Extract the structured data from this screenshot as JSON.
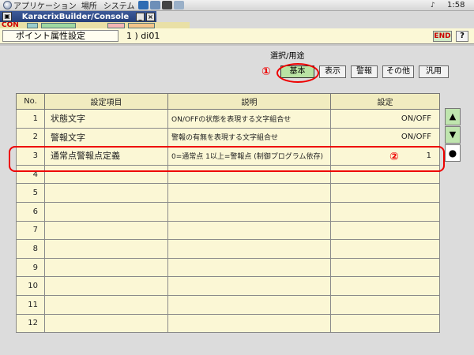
{
  "system_panel": {
    "menu_applications": "アプリケーション",
    "menu_places": "場所",
    "menu_system": "システム",
    "clock": "1:58"
  },
  "window": {
    "title": "KaracrixBuilder/Console",
    "toolbar_label": "CON"
  },
  "header": {
    "screen_name": "ポイント属性設定",
    "point_name": "1 ) di01",
    "end_label": "END",
    "help_label": "?"
  },
  "categories": {
    "label": "選択/用途",
    "buttons": [
      "基本",
      "表示",
      "警報",
      "その他",
      "汎用"
    ],
    "active_index": 0
  },
  "markers": {
    "one": "①",
    "two": "②"
  },
  "table": {
    "headers": [
      "No.",
      "設定項目",
      "説明",
      "設定"
    ],
    "rows": [
      {
        "no": "1",
        "item": "状態文字",
        "desc": "ON/OFFの状態を表現する文字組合せ",
        "value": "ON/OFF"
      },
      {
        "no": "2",
        "item": "警報文字",
        "desc": "警報の有無を表現する文字組合せ",
        "value": "ON/OFF"
      },
      {
        "no": "3",
        "item": "通常点警報点定義",
        "desc": "0=通常点 1以上=警報点 (制御プログラム依存)",
        "value": "1"
      },
      {
        "no": "4",
        "item": "",
        "desc": "",
        "value": ""
      },
      {
        "no": "5",
        "item": "",
        "desc": "",
        "value": ""
      },
      {
        "no": "6",
        "item": "",
        "desc": "",
        "value": ""
      },
      {
        "no": "7",
        "item": "",
        "desc": "",
        "value": ""
      },
      {
        "no": "8",
        "item": "",
        "desc": "",
        "value": ""
      },
      {
        "no": "9",
        "item": "",
        "desc": "",
        "value": ""
      },
      {
        "no": "10",
        "item": "",
        "desc": "",
        "value": ""
      },
      {
        "no": "11",
        "item": "",
        "desc": "",
        "value": ""
      },
      {
        "no": "12",
        "item": "",
        "desc": "",
        "value": ""
      }
    ]
  },
  "scroll": {
    "up": "▲",
    "down": "▼",
    "home": "●"
  },
  "icons": {
    "foot": "foot-icon",
    "quick_launch": [
      "browser-icon",
      "mail-icon",
      "terminal-icon",
      "editor-icon"
    ],
    "window_minimize": "minimize-icon",
    "window_close": "close-icon"
  },
  "colors": {
    "title_bar": "#26407a",
    "header_bg": "#fbf8d6",
    "table_bg": "#fbf7d5",
    "active_button": "#b9e3a3",
    "annotation": "#e00000"
  }
}
